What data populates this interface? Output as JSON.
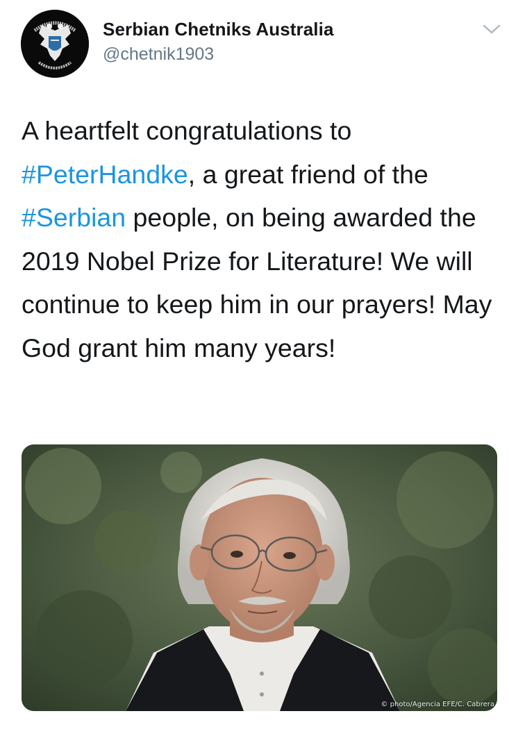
{
  "account": {
    "display_name": "Serbian Chetniks Australia",
    "handle": "@chetnik1903",
    "avatar_icon": "double-headed-eagle-emblem-icon"
  },
  "menu": {
    "icon": "chevron-down-icon"
  },
  "tweet": {
    "part1": "A heartfelt congratulations to ",
    "hashtag1": "#PeterHandke",
    "part2": ", a great friend of the ",
    "hashtag2": "#Serbian",
    "part3": " people, on being awarded the 2019 Nobel Prize for Literature! We will continue to keep him in our prayers! May God grant him many years!"
  },
  "media": {
    "credit": "© photo/Agencia EFE/C. Cabrera"
  },
  "colors": {
    "hashtag": "#1b95e0",
    "text": "#14171a",
    "secondary": "#657786"
  }
}
